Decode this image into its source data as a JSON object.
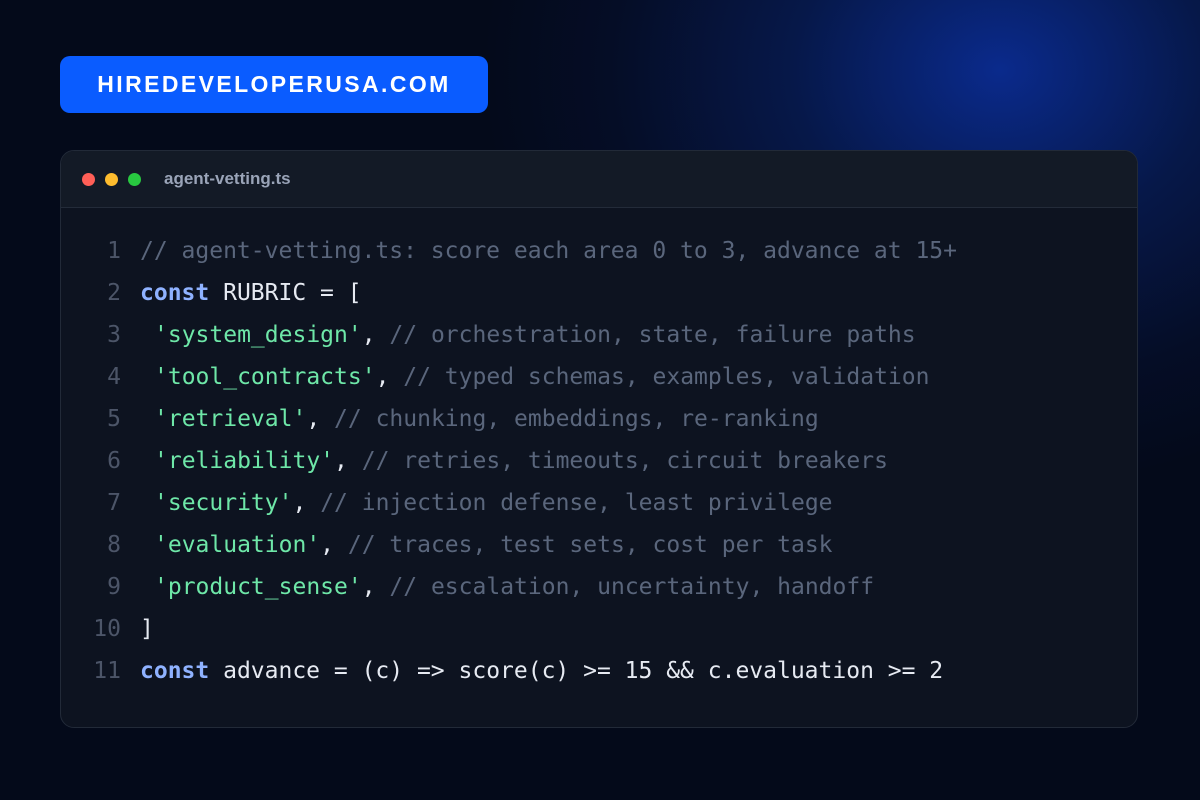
{
  "brand": {
    "label": "HIREDEVELOPERUSA.COM"
  },
  "window": {
    "filename": "agent-vetting.ts",
    "controls": [
      "close",
      "minimize",
      "maximize"
    ]
  },
  "code": {
    "lines": [
      {
        "number": "1",
        "comment": "// agent-vetting.ts: score each area 0 to 3, advance at 15+"
      },
      {
        "number": "2",
        "keyword": "const",
        "text": " RUBRIC = ["
      },
      {
        "number": "3",
        "string": "'system_design'",
        "punct": ", ",
        "comment": "// orchestration, state, failure paths"
      },
      {
        "number": "4",
        "string": "'tool_contracts'",
        "punct": ", ",
        "comment": "// typed schemas, examples, validation"
      },
      {
        "number": "5",
        "string": "'retrieval'",
        "punct": ", ",
        "comment": "// chunking, embeddings, re-ranking"
      },
      {
        "number": "6",
        "string": "'reliability'",
        "punct": ", ",
        "comment": "// retries, timeouts, circuit breakers"
      },
      {
        "number": "7",
        "string": "'security'",
        "punct": ", ",
        "comment": "// injection defense, least privilege"
      },
      {
        "number": "8",
        "string": "'evaluation'",
        "punct": ", ",
        "comment": "// traces, test sets, cost per task"
      },
      {
        "number": "9",
        "string": "'product_sense'",
        "punct": ", ",
        "comment": "// escalation, uncertainty, handoff"
      },
      {
        "number": "10",
        "text": "]"
      },
      {
        "number": "11",
        "keyword": "const",
        "text": " advance = (c) => score(c) >= 15 && c.evaluation >= 2"
      }
    ]
  },
  "colors": {
    "brand_background": "#0a5cff",
    "keyword": "#8fb2ff",
    "string": "#6ee7a8",
    "comment": "#5a667c",
    "line_number": "#4c5568"
  }
}
